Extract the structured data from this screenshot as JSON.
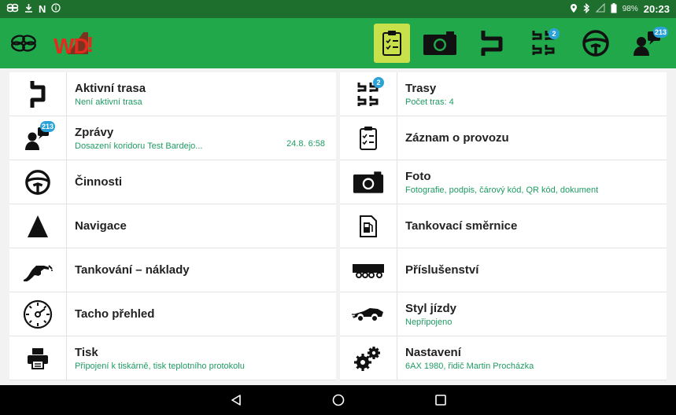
{
  "status_bar": {
    "battery": "98%",
    "time": "20:23"
  },
  "app": {
    "logo_text": "WD"
  },
  "colors": {
    "topbar": "#21a84a",
    "status": "#1e6e2d",
    "accent_green": "#1e9c62",
    "badge": "#2ba3d9"
  },
  "toolbar": {
    "badges": {
      "routes": "2",
      "messages": "213"
    }
  },
  "menu": {
    "aktivni_trasa": {
      "title": "Aktivní trasa",
      "sub": "Není aktivní trasa"
    },
    "trasy": {
      "title": "Trasy",
      "sub": "Počet tras: 4",
      "badge": "2"
    },
    "zpravy": {
      "title": "Zprávy",
      "sub": "Dosazení koridoru Test Bardejo...",
      "meta": "24.8. 6:58",
      "badge": "213"
    },
    "zaznam": {
      "title": "Záznam o provozu"
    },
    "cinnosti": {
      "title": "Činnosti"
    },
    "foto": {
      "title": "Foto",
      "sub": "Fotografie, podpis, čárový kód, QR kód, dokument"
    },
    "navigace": {
      "title": "Navigace"
    },
    "tankovaci": {
      "title": "Tankovací směrnice"
    },
    "tankovani": {
      "title": "Tankování – náklady"
    },
    "prislusenstvi": {
      "title": "Příslušenství"
    },
    "tacho": {
      "title": "Tacho přehled"
    },
    "styl": {
      "title": "Styl jízdy",
      "sub": "Nepřipojeno"
    },
    "tisk": {
      "title": "Tisk",
      "sub": "Připojení k tiskárně, tisk teplotního protokolu"
    },
    "nastaveni": {
      "title": "Nastavení",
      "sub": "6AX 1980, řidič Martin Procházka"
    }
  }
}
